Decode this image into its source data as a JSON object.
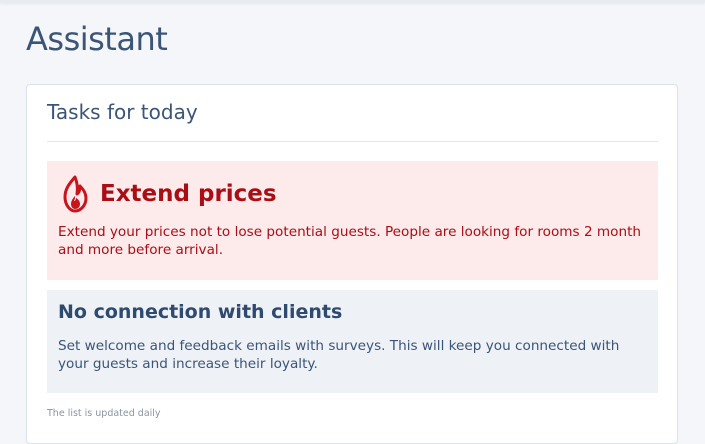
{
  "page": {
    "title": "Assistant"
  },
  "card": {
    "title": "Tasks for today",
    "footnote": "The list is updated daily"
  },
  "tasks": [
    {
      "icon": "flame-icon",
      "title": "Extend prices",
      "text": "Extend your prices not to lose potential guests. People are looking for rooms 2 month and more before arrival.",
      "color": "#a90e16",
      "background": "#fdeaea"
    },
    {
      "icon": "",
      "title": "No connection with clients",
      "text": "Set welcome and feedback emails with surveys. This will keep you connected with your guests and increase their loyalty.",
      "color": "#2e4a6e",
      "background": "#eef1f5"
    }
  ]
}
